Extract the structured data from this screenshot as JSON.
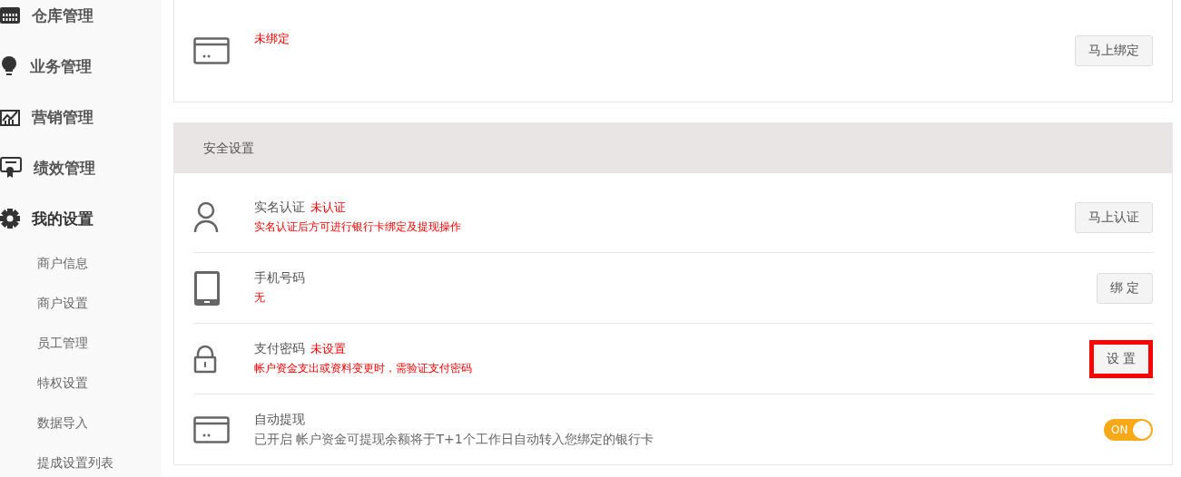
{
  "sidebar": {
    "groups": [
      {
        "label": "仓库管理",
        "expanded": false
      },
      {
        "label": "业务管理",
        "expanded": false
      },
      {
        "label": "营销管理",
        "expanded": false
      },
      {
        "label": "绩效管理",
        "expanded": false
      },
      {
        "label": "我的设置",
        "expanded": true,
        "children": [
          {
            "label": "商户信息"
          },
          {
            "label": "商户设置"
          },
          {
            "label": "员工管理"
          },
          {
            "label": "特权设置"
          },
          {
            "label": "数据导入"
          },
          {
            "label": "提成设置列表"
          }
        ]
      }
    ]
  },
  "bank_card": {
    "status": "未绑定",
    "button": "马上绑定"
  },
  "security": {
    "title": "安全设置",
    "rows": [
      {
        "kind": "button",
        "title": "实名认证",
        "status": "未认证",
        "note": "实名认证后方可进行银行卡绑定及提现操作",
        "alert": true,
        "button": {
          "label": "马上认证",
          "highlighted": false
        }
      },
      {
        "kind": "button",
        "title": "手机号码",
        "note": "无",
        "alert": true,
        "button": {
          "label": "绑 定",
          "highlighted": false
        }
      },
      {
        "kind": "button",
        "title": "支付密码",
        "status": "未设置",
        "note": "帐户资金支出或资料变更时，需验证支付密码",
        "alert": true,
        "button": {
          "label": "设 置",
          "highlighted": true
        }
      },
      {
        "kind": "toggle",
        "title": "自动提现",
        "note": "已开启 帐户资金可提现余额将于T+1个工作日自动转入您绑定的银行卡",
        "alert": false,
        "toggle": {
          "on": true,
          "label": "ON"
        }
      }
    ]
  }
}
